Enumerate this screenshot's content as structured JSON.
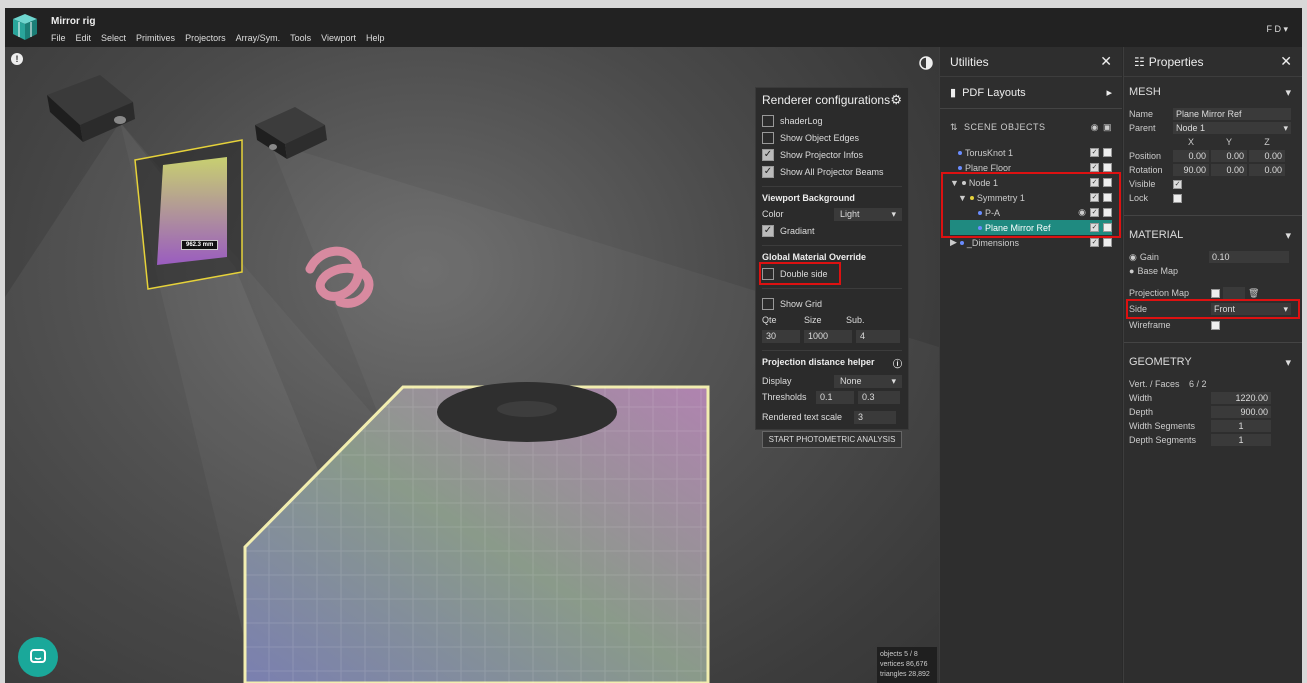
{
  "app": {
    "title": "Mirror rig",
    "user": "F D ▾"
  },
  "menu": [
    "File",
    "Edit",
    "Select",
    "Primitives",
    "Projectors",
    "Array/Sym.",
    "Tools",
    "Viewport",
    "Help"
  ],
  "viewport": {
    "measure_label": "962.3 mm",
    "stats": [
      "objects 5 / 8",
      "vertices 86,676",
      "triangles 28,892"
    ]
  },
  "renderer": {
    "title": "Renderer configurations",
    "checkboxes": [
      {
        "label": "shaderLog",
        "checked": false
      },
      {
        "label": "Show Object Edges",
        "checked": false
      },
      {
        "label": "Show Projector Infos",
        "checked": true
      },
      {
        "label": "Show All Projector Beams",
        "checked": true
      }
    ],
    "background": {
      "heading": "Viewport Background",
      "color_label": "Color",
      "color_value": "Light",
      "gradiant_label": "Gradiant",
      "gradiant_checked": true
    },
    "material_override": {
      "heading": "Global Material Override",
      "double_side_label": "Double side",
      "double_side_checked": false
    },
    "grid": {
      "show_label": "Show Grid",
      "qte_label": "Qte",
      "size_label": "Size",
      "sub_label": "Sub.",
      "qte": "30",
      "size": "1000",
      "sub": "4"
    },
    "projection": {
      "heading": "Projection distance helper",
      "display_label": "Display",
      "display_value": "None",
      "thresholds_label": "Thresholds",
      "threshold_a": "0.1",
      "threshold_b": "0.3",
      "text_scale_label": "Rendered text scale",
      "text_scale": "3"
    },
    "analysis_button": "START PHOTOMETRIC ANALYSIS"
  },
  "utilities": {
    "title": "Utilities",
    "pdf_layouts": "PDF Layouts",
    "scene_objects": "SCENE OBJECTS",
    "tree": [
      {
        "label": "TorusKnot 1",
        "indent": 0,
        "arrow": "",
        "color": "#6a8cff"
      },
      {
        "label": "Plane Floor",
        "indent": 0,
        "arrow": "",
        "color": "#6a8cff"
      },
      {
        "label": "Node 1",
        "indent": 0,
        "arrow": "▼",
        "color": "#ccc"
      },
      {
        "label": "Symmetry 1",
        "indent": 1,
        "arrow": "▼",
        "color": "#e6d23a"
      },
      {
        "label": "P-A",
        "indent": 2,
        "arrow": "",
        "color": "#6a8cff"
      },
      {
        "label": "Plane Mirror Ref",
        "indent": 2,
        "arrow": "",
        "color": "#6a8cff"
      },
      {
        "label": "_Dimensions",
        "indent": 0,
        "arrow": "▶",
        "color": "#6a8cff"
      }
    ]
  },
  "properties": {
    "title": "Properties",
    "mesh": {
      "heading": "MESH",
      "name_label": "Name",
      "name_value": "Plane Mirror Ref",
      "parent_label": "Parent",
      "parent_value": "Node 1",
      "axes": [
        "X",
        "Y",
        "Z"
      ],
      "position_label": "Position",
      "position": [
        "0.00",
        "0.00",
        "0.00"
      ],
      "rotation_label": "Rotation",
      "rotation": [
        "90.00",
        "0.00",
        "0.00"
      ],
      "visible_label": "Visible",
      "lock_label": "Lock"
    },
    "material": {
      "heading": "MATERIAL",
      "gain_label": "Gain",
      "gain_value": "0.10",
      "base_map_label": "Base Map",
      "projection_map_label": "Projection Map",
      "side_label": "Side",
      "side_value": "Front",
      "wireframe_label": "Wireframe"
    },
    "geometry": {
      "heading": "GEOMETRY",
      "vert_faces_label": "Vert. / Faces",
      "vert_faces_value": "6 / 2",
      "width_label": "Width",
      "width_value": "1220.00",
      "depth_label": "Depth",
      "depth_value": "900.00",
      "width_seg_label": "Width Segments",
      "width_seg_value": "1",
      "depth_seg_label": "Depth Segments",
      "depth_seg_value": "1"
    }
  },
  "colors": {
    "accent": "#1aa89a",
    "highlight": "#d11111",
    "selected_row": "#1f8a80"
  }
}
